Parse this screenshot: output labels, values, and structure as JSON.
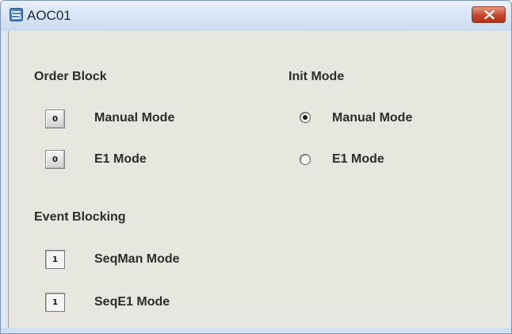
{
  "window": {
    "title": "AOC01",
    "close_icon": "close-x-icon",
    "app_icon": "window-app-icon"
  },
  "order_block": {
    "heading": "Order Block",
    "items": [
      {
        "indicator": "0",
        "label": "Manual Mode"
      },
      {
        "indicator": "0",
        "label": "E1 Mode"
      }
    ]
  },
  "init_mode": {
    "heading": "Init Mode",
    "options": [
      {
        "label": "Manual Mode",
        "selected": true
      },
      {
        "label": "E1 Mode",
        "selected": false
      }
    ]
  },
  "event_blocking": {
    "heading": "Event Blocking",
    "items": [
      {
        "indicator": "1",
        "label": "SeqMan Mode"
      },
      {
        "indicator": "1",
        "label": "SeqE1 Mode"
      }
    ]
  },
  "colors": {
    "close_button": "#c5452b",
    "titlebar": "#dfe9f5",
    "client_bg": "#e8e7df"
  }
}
